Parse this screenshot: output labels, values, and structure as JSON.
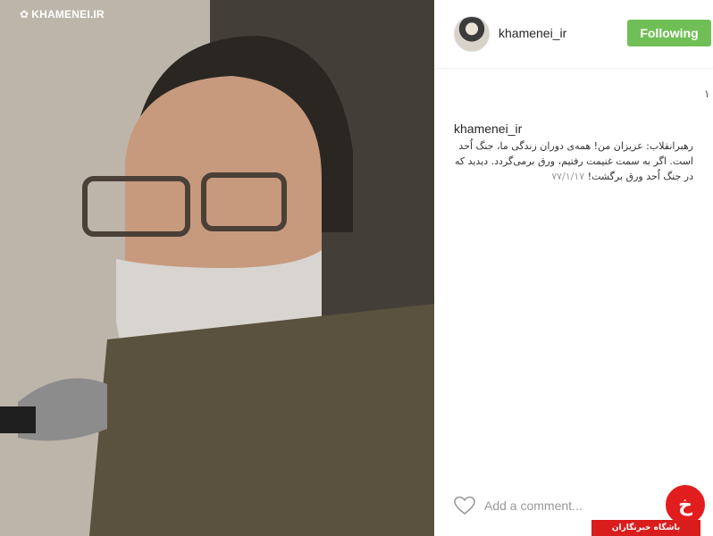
{
  "post": {
    "image_watermark": "KHAMENEI.IR",
    "image_icon": "flower-logo-icon"
  },
  "header": {
    "username": "khamenei_ir",
    "follow_label": "Following"
  },
  "likes": {
    "count": "۱"
  },
  "caption": {
    "username": "khamenei_ir",
    "text": "رهبرانقلاب: عزیزان من! همه‌ی دوران زندگی ما، جنگ اُحد است. اگر به سمت غنیمت رفتیم، ورق برمی‌گردد. دیدید که در جنگ اُحد ورق برگشت!",
    "date": "۷۷/۱/۱۷"
  },
  "footer": {
    "comment_placeholder": "Add a comment...",
    "like_icon": "heart-icon"
  },
  "badge": {
    "logo_text": "خ",
    "label": "باشگاه خبرنگاران"
  },
  "colors": {
    "follow_button": "#6fbf56",
    "badge_red": "#e21d1d"
  }
}
